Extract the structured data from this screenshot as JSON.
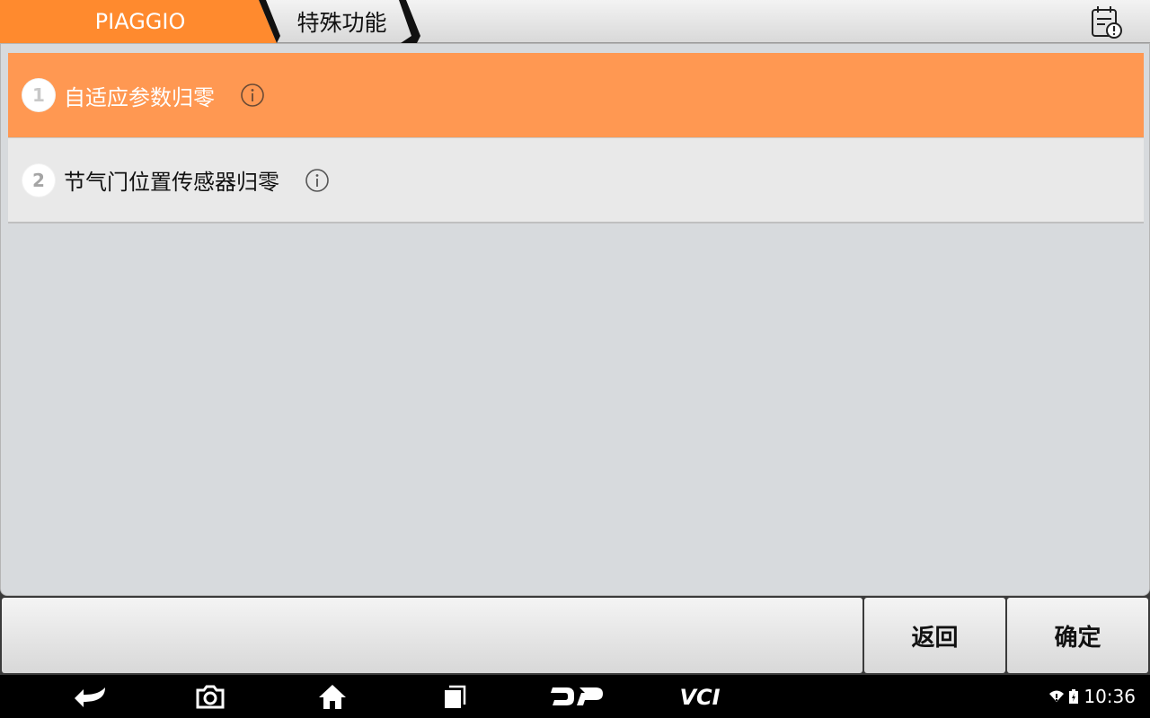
{
  "header": {
    "breadcrumb": [
      "PIAGGIO",
      "特殊功能"
    ],
    "report_icon": "report-alert-icon",
    "accent_color": "#ff8a2e"
  },
  "list": {
    "items": [
      {
        "number": "1",
        "label": "自适应参数归零",
        "selected": true
      },
      {
        "number": "2",
        "label": "节气门位置传感器归零",
        "selected": false
      }
    ],
    "selected_color": "#ff9852",
    "info_icon": "info-icon"
  },
  "actions": {
    "back_label": "返回",
    "confirm_label": "确定"
  },
  "navbar": {
    "icons": [
      "back-icon",
      "camera-icon",
      "home-icon",
      "recent-apps-icon",
      "dp-logo-icon",
      "vci-icon"
    ],
    "dp_text": "DP",
    "vci_text": "VCI",
    "time": "10:36"
  }
}
